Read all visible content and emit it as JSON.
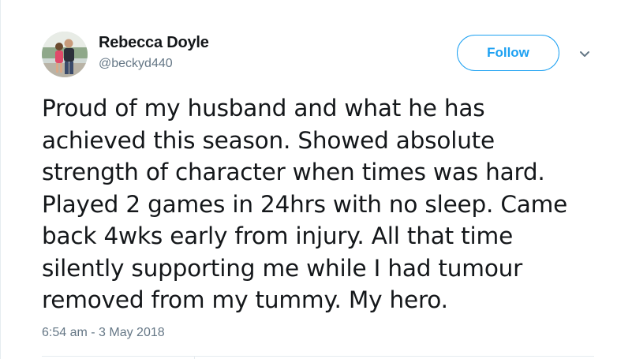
{
  "author": {
    "name": "Rebecca Doyle",
    "handle": "@beckyd440",
    "avatar_icon": "profile-photo-avatar"
  },
  "follow_label": "Follow",
  "menu_icon": "chevron-down-icon",
  "tweet_text": "Proud of my husband and what he has\nachieved this season. Showed absolute\nstrength of character when times was hard.\nPlayed 2 games in 24hrs with no sleep. Came\nback 4wks early from injury. All that time\nsilently supporting me while I had tumour\nremoved from my tummy. My hero.",
  "timestamp": "6:54 am - 3 May 2018",
  "colors": {
    "accent": "#1da1f2",
    "text": "#14171a",
    "secondary": "#657786",
    "border": "#e6ecf0"
  }
}
